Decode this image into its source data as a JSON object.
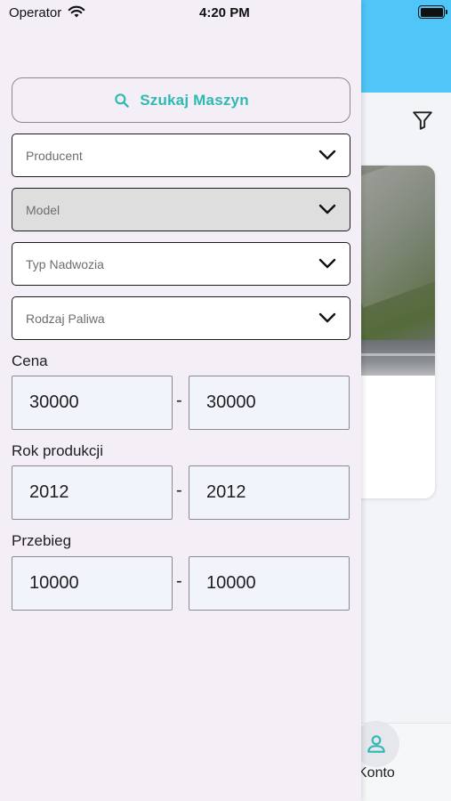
{
  "status_bar": {
    "carrier": "Operator",
    "time": "4:20 PM"
  },
  "drawer": {
    "search_button": {
      "label": "Szukaj Maszyn",
      "color": "#2fb9b2"
    },
    "selects": [
      {
        "placeholder": "Producent",
        "disabled": false
      },
      {
        "placeholder": "Model",
        "disabled": true
      },
      {
        "placeholder": "Typ Nadwozia",
        "disabled": false
      },
      {
        "placeholder": "Rodzaj Paliwa",
        "disabled": false
      }
    ],
    "price": {
      "label": "Cena",
      "from": "30000",
      "separator": "-",
      "to": "30000"
    },
    "year": {
      "label": "Rok produkcji",
      "from": "2012",
      "separator": "-",
      "to": "2012"
    },
    "mileage": {
      "label": "Przebieg",
      "from": "10000",
      "separator": "-",
      "to": "10000"
    }
  },
  "background": {
    "header_color": "#4fc6f7",
    "bottom_nav": {
      "active_tab_label": "Konto"
    }
  }
}
